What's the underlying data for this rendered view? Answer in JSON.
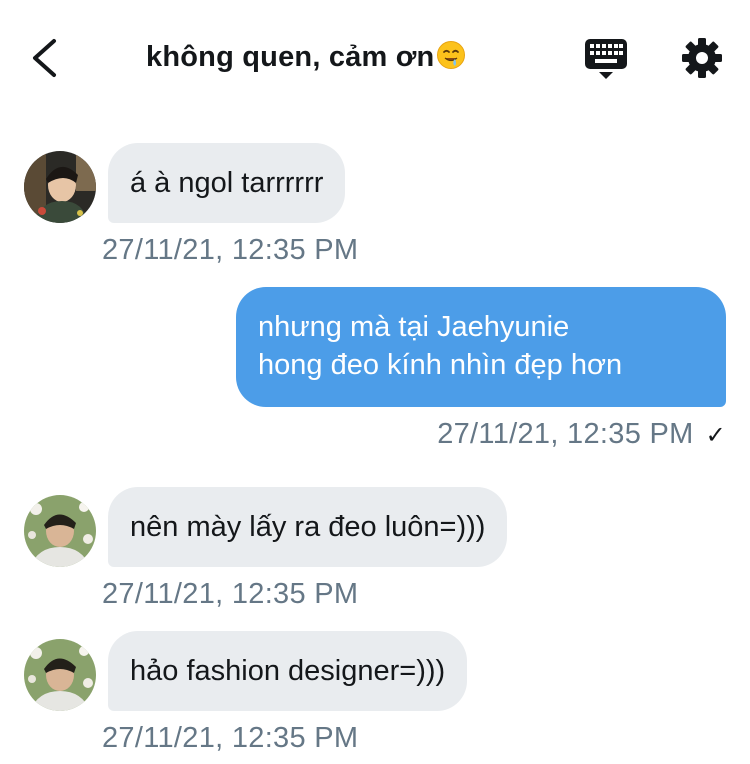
{
  "header": {
    "title": "không quen, cảm ơn",
    "title_emoji": "drooling-face-emoji",
    "back_icon": "chevron-left-icon",
    "keyboard_icon": "keyboard-icon",
    "settings_icon": "gear-icon"
  },
  "colors": {
    "incoming_bubble": "#e9ecef",
    "outgoing_bubble": "#4c9de8",
    "timestamp": "#657786",
    "text": "#14171a"
  },
  "messages": [
    {
      "direction": "in",
      "text": "á à ngol tarrrrrr",
      "time": "27/11/21, 12:35 PM"
    },
    {
      "direction": "out",
      "line1": "nhưng mà tại Jaehyunie",
      "line2": "hong đeo kính nhìn đẹp hơn",
      "time": "27/11/21, 12:35 PM",
      "status_icon": "check-icon"
    },
    {
      "direction": "in",
      "text": "nên mày lấy ra đeo luôn=)))",
      "time": "27/11/21, 12:35 PM"
    },
    {
      "direction": "in",
      "text": "hảo fashion designer=)))",
      "time": "27/11/21, 12:35 PM"
    }
  ]
}
